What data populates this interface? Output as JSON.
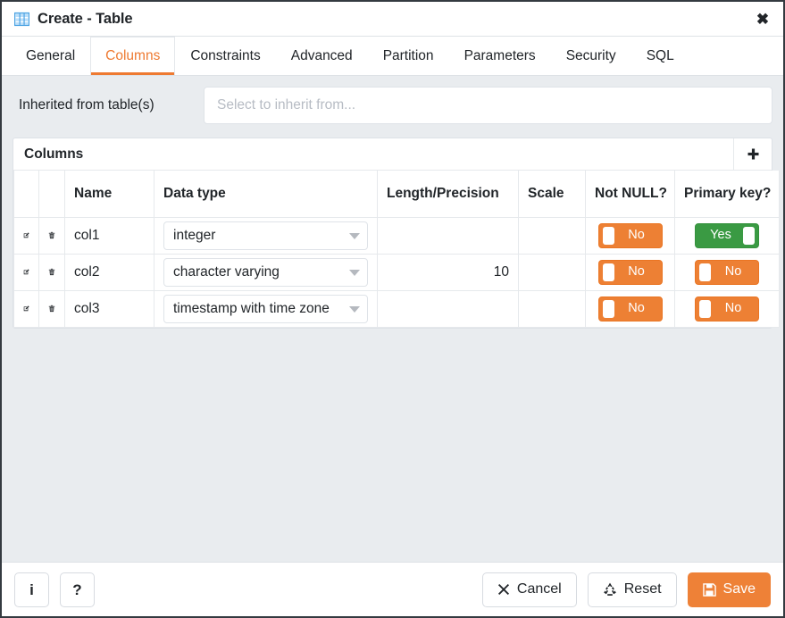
{
  "window": {
    "title": "Create - Table",
    "icon": "table-icon",
    "close_label": "✖"
  },
  "tabs": [
    {
      "label": "General",
      "active": false
    },
    {
      "label": "Columns",
      "active": true
    },
    {
      "label": "Constraints",
      "active": false
    },
    {
      "label": "Advanced",
      "active": false
    },
    {
      "label": "Partition",
      "active": false
    },
    {
      "label": "Parameters",
      "active": false
    },
    {
      "label": "Security",
      "active": false
    },
    {
      "label": "SQL",
      "active": false
    }
  ],
  "inherit": {
    "label": "Inherited from table(s)",
    "placeholder": "Select to inherit from...",
    "value": ""
  },
  "columns_panel": {
    "title": "Columns",
    "add_label": "✚",
    "headers": [
      "",
      "",
      "Name",
      "Data type",
      "Length/Precision",
      "Scale",
      "Not NULL?",
      "Primary key?"
    ],
    "rows": [
      {
        "edit_icon": "edit-icon",
        "delete_icon": "trash-icon",
        "name": "col1",
        "data_type": "integer",
        "length": "",
        "scale": "",
        "not_null": "No",
        "not_null_on": false,
        "primary_key": "Yes",
        "primary_key_on": true
      },
      {
        "edit_icon": "edit-icon",
        "delete_icon": "trash-icon",
        "name": "col2",
        "data_type": "character varying",
        "length": "10",
        "scale": "",
        "not_null": "No",
        "not_null_on": false,
        "primary_key": "No",
        "primary_key_on": false
      },
      {
        "edit_icon": "edit-icon",
        "delete_icon": "trash-icon",
        "name": "col3",
        "data_type": "timestamp with time zone",
        "length": "",
        "scale": "",
        "not_null": "No",
        "not_null_on": false,
        "primary_key": "No",
        "primary_key_on": false
      }
    ]
  },
  "footer": {
    "info_label": "i",
    "help_label": "?",
    "cancel_label": "Cancel",
    "reset_label": "Reset",
    "save_label": "Save"
  },
  "colors": {
    "accent": "#ee7a31",
    "save": "#ee8137",
    "toggle_off": "#ed8034",
    "toggle_on": "#3a9a43",
    "body_bg": "#e9ecef",
    "border": "#343a40"
  }
}
